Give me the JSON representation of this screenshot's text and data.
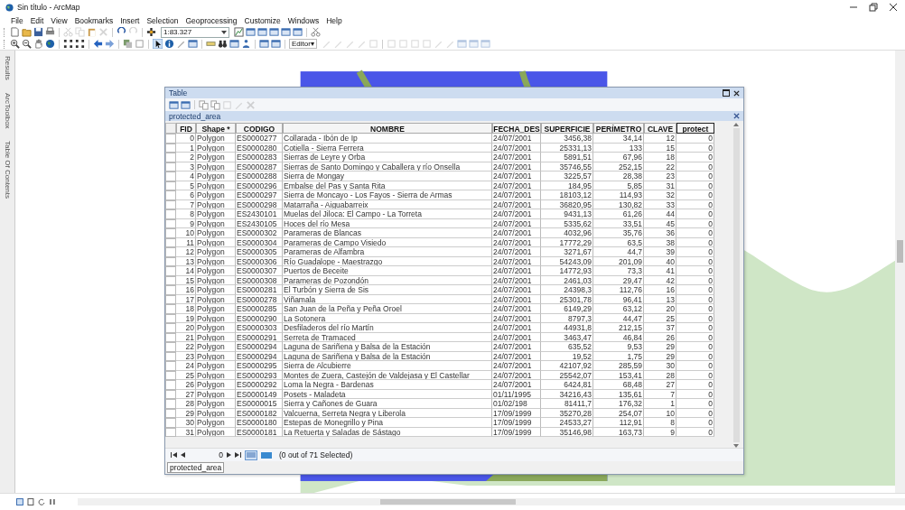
{
  "window": {
    "title": "Sin título - ArcMap"
  },
  "menu": [
    "File",
    "Edit",
    "View",
    "Bookmarks",
    "Insert",
    "Selection",
    "Geoprocessing",
    "Customize",
    "Windows",
    "Help"
  ],
  "standard_toolbar": {
    "scale": "1:83.327"
  },
  "tools_toolbar": {
    "editor": "Editor▾"
  },
  "side_tabs": [
    "Results",
    "ArcToolbox",
    "Table Of Contents"
  ],
  "table_window": {
    "title": "Table",
    "tab_title": "protected_area",
    "columns": [
      {
        "label": "FID",
        "kind": "number",
        "selected": false
      },
      {
        "label": "Shape *",
        "kind": "text",
        "selected": false
      },
      {
        "label": "CODIGO",
        "kind": "text",
        "selected": false
      },
      {
        "label": "NOMBRE",
        "kind": "text",
        "selected": false
      },
      {
        "label": "FECHA_DES",
        "kind": "text",
        "selected": false
      },
      {
        "label": "SUPERFICIE",
        "kind": "number",
        "selected": false
      },
      {
        "label": "PERÍMETRO",
        "kind": "number",
        "selected": false
      },
      {
        "label": "CLAVE",
        "kind": "number",
        "selected": false
      },
      {
        "label": "protect",
        "kind": "number",
        "selected": true
      }
    ],
    "rows": [
      [
        "0",
        "Polygon",
        "ES0000277",
        "Collarada - Ibón de Ip",
        "24/07/2001",
        "3456,38",
        "34,14",
        "12",
        "0"
      ],
      [
        "1",
        "Polygon",
        "ES0000280",
        "Cotiella - Sierra Ferrera",
        "24/07/2001",
        "25331,13",
        "133",
        "15",
        "0"
      ],
      [
        "2",
        "Polygon",
        "ES0000283",
        "Sierras de Leyre y Orba",
        "24/07/2001",
        "5891,51",
        "67,96",
        "18",
        "0"
      ],
      [
        "3",
        "Polygon",
        "ES0000287",
        "Sierras de Santo Domingo y Caballera y río Onsella",
        "24/07/2001",
        "35746,55",
        "252,15",
        "22",
        "0"
      ],
      [
        "4",
        "Polygon",
        "ES0000288",
        "Sierra de Mongay",
        "24/07/2001",
        "3225,57",
        "28,38",
        "23",
        "0"
      ],
      [
        "5",
        "Polygon",
        "ES0000296",
        "Embalse del Pas y Santa Rita",
        "24/07/2001",
        "184,95",
        "5,85",
        "31",
        "0"
      ],
      [
        "6",
        "Polygon",
        "ES0000297",
        "Sierra de Moncayo - Los Fayos - Sierra de Armas",
        "24/07/2001",
        "18103,12",
        "114,93",
        "32",
        "0"
      ],
      [
        "7",
        "Polygon",
        "ES0000298",
        "Matarraña - Aiguabarreix",
        "24/07/2001",
        "36820,95",
        "130,82",
        "33",
        "0"
      ],
      [
        "8",
        "Polygon",
        "ES2430101",
        "Muelas del Jiloca: El Campo - La Torreta",
        "24/07/2001",
        "9431,13",
        "61,26",
        "44",
        "0"
      ],
      [
        "9",
        "Polygon",
        "ES2430105",
        "Hoces del río Mesa",
        "24/07/2001",
        "5335,62",
        "33,51",
        "45",
        "0"
      ],
      [
        "10",
        "Polygon",
        "ES0000302",
        "Parameras de Blancas",
        "24/07/2001",
        "4032,96",
        "35,76",
        "36",
        "0"
      ],
      [
        "11",
        "Polygon",
        "ES0000304",
        "Parameras de Campo Visiedo",
        "24/07/2001",
        "17772,29",
        "63,5",
        "38",
        "0"
      ],
      [
        "12",
        "Polygon",
        "ES0000305",
        "Parameras de Alfambra",
        "24/07/2001",
        "3271,67",
        "44,7",
        "39",
        "0"
      ],
      [
        "13",
        "Polygon",
        "ES0000306",
        "Río Guadalope - Maestrazgo",
        "24/07/2001",
        "54243,09",
        "201,09",
        "40",
        "0"
      ],
      [
        "14",
        "Polygon",
        "ES0000307",
        "Puertos de Beceite",
        "24/07/2001",
        "14772,93",
        "73,3",
        "41",
        "0"
      ],
      [
        "15",
        "Polygon",
        "ES0000308",
        "Parameras de Pozondón",
        "24/07/2001",
        "2461,03",
        "29,47",
        "42",
        "0"
      ],
      [
        "16",
        "Polygon",
        "ES0000281",
        "El Turbón y Sierra de Sis",
        "24/07/2001",
        "24398,3",
        "112,76",
        "16",
        "0"
      ],
      [
        "17",
        "Polygon",
        "ES0000278",
        "Viñamala",
        "24/07/2001",
        "25301,78",
        "96,41",
        "13",
        "0"
      ],
      [
        "18",
        "Polygon",
        "ES0000285",
        "San Juan de la Peña y Peña Oroel",
        "24/07/2001",
        "6149,29",
        "63,12",
        "20",
        "0"
      ],
      [
        "19",
        "Polygon",
        "ES0000290",
        "La Sotonera",
        "24/07/2001",
        "8797,3",
        "44,47",
        "25",
        "0"
      ],
      [
        "20",
        "Polygon",
        "ES0000303",
        "Desfiladeros del río Martín",
        "24/07/2001",
        "44931,8",
        "212,15",
        "37",
        "0"
      ],
      [
        "21",
        "Polygon",
        "ES0000291",
        "Serreta de Tramaced",
        "24/07/2001",
        "3463,47",
        "46,84",
        "26",
        "0"
      ],
      [
        "22",
        "Polygon",
        "ES0000294",
        "Laguna de Sariñena y Balsa de la Estación",
        "24/07/2001",
        "635,52",
        "9,53",
        "29",
        "0"
      ],
      [
        "23",
        "Polygon",
        "ES0000294",
        "Laguna de Sariñena y Balsa de la Estación",
        "24/07/2001",
        "19,52",
        "1,75",
        "29",
        "0"
      ],
      [
        "24",
        "Polygon",
        "ES0000295",
        "Sierra de Alcubierre",
        "24/07/2001",
        "42107,92",
        "285,59",
        "30",
        "0"
      ],
      [
        "25",
        "Polygon",
        "ES0000293",
        "Montes de Zuera, Castejón de Valdejasa y El Castellar",
        "24/07/2001",
        "25542,07",
        "153,41",
        "28",
        "0"
      ],
      [
        "26",
        "Polygon",
        "ES0000292",
        "Loma la Negra - Bardenas",
        "24/07/2001",
        "6424,81",
        "68,48",
        "27",
        "0"
      ],
      [
        "27",
        "Polygon",
        "ES0000149",
        "Posets - Maladeta",
        "01/11/1995",
        "34216,43",
        "135,61",
        "7",
        "0"
      ],
      [
        "28",
        "Polygon",
        "ES0000015",
        "Sierra y Cañones de Guara",
        "01/02/198",
        "81411,7",
        "176,32",
        "1",
        "0"
      ],
      [
        "29",
        "Polygon",
        "ES0000182",
        "Valcuerna, Serreta Negra y Liberola",
        "17/09/1999",
        "35270,28",
        "254,07",
        "10",
        "0"
      ],
      [
        "30",
        "Polygon",
        "ES0000180",
        "Estepas de Monegrillo y Pina",
        "17/09/1999",
        "24533,27",
        "112,91",
        "8",
        "0"
      ],
      [
        "31",
        "Polygon",
        "ES0000181",
        "La Retuerta y Saladas de Sástago",
        "17/09/1999",
        "35146,98",
        "163,73",
        "9",
        "0"
      ]
    ],
    "record": "0",
    "selection_status": "(0 out of 71 Selected)",
    "bottom_tab": "protected_area"
  }
}
